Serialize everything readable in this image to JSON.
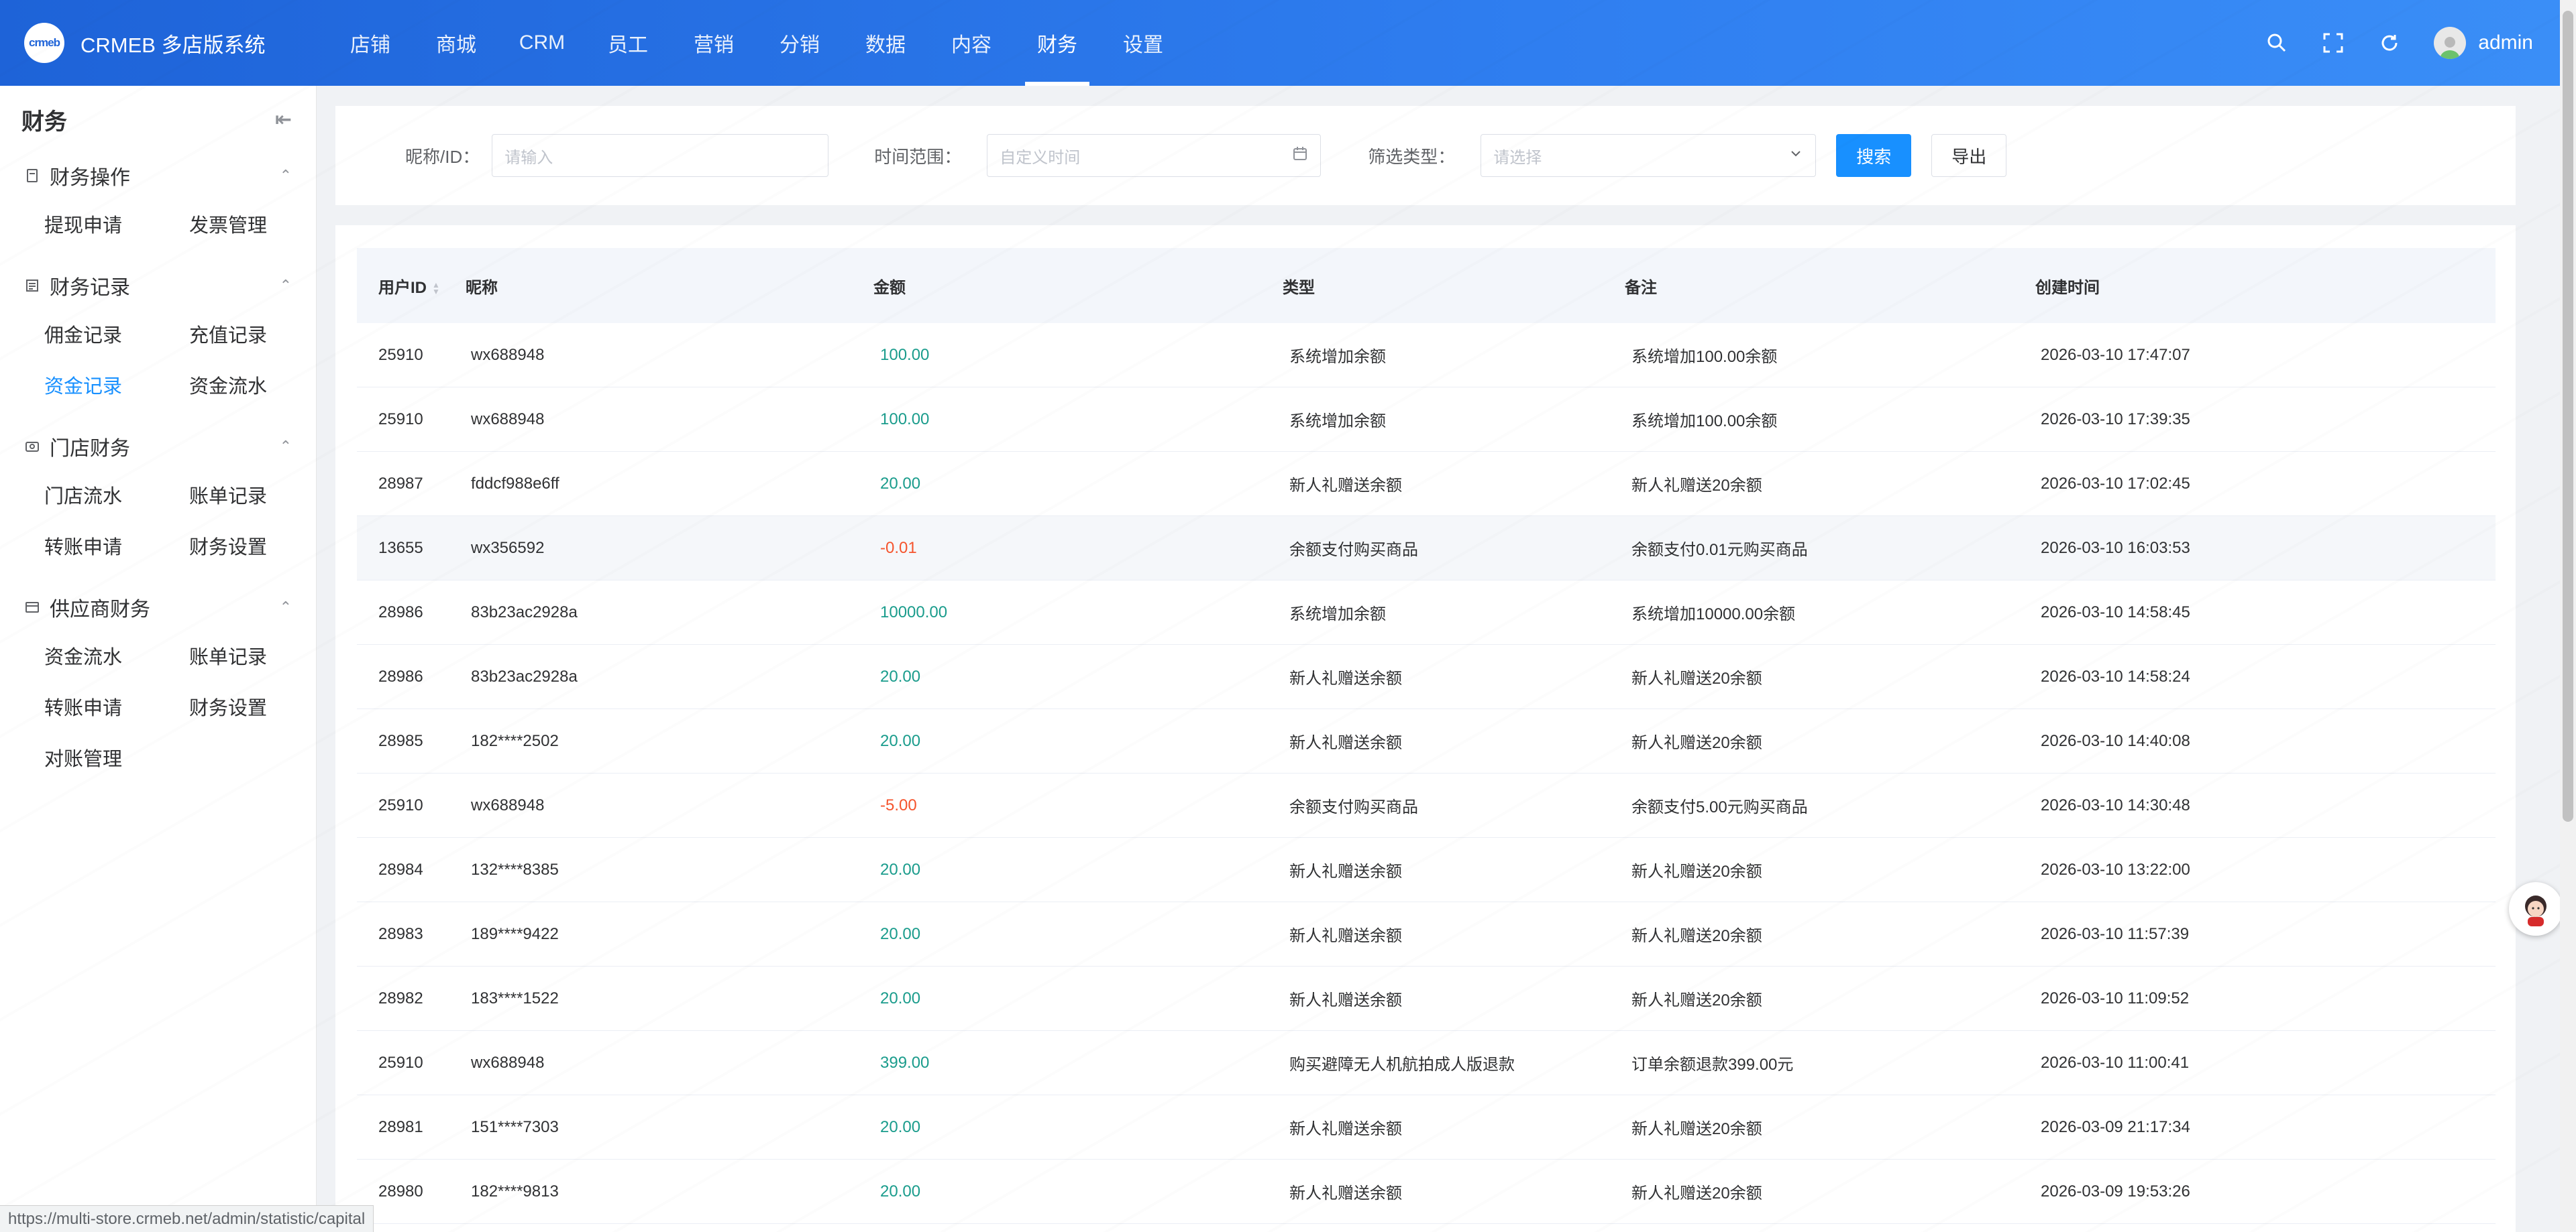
{
  "header": {
    "logo_text": "crmeb",
    "app_title": "CRMEB 多店版系统",
    "nav": [
      "店铺",
      "商城",
      "CRM",
      "员工",
      "营销",
      "分销",
      "数据",
      "内容",
      "财务",
      "设置"
    ],
    "active_nav": "财务",
    "user_name": "admin"
  },
  "sidebar": {
    "title": "财务",
    "groups": [
      {
        "label": "财务操作",
        "icon": "document-icon",
        "items": [
          "提现申请",
          "发票管理"
        ]
      },
      {
        "label": "财务记录",
        "icon": "list-icon",
        "items": [
          "佣金记录",
          "充值记录",
          "资金记录",
          "资金流水"
        ]
      },
      {
        "label": "门店财务",
        "icon": "store-icon",
        "items": [
          "门店流水",
          "账单记录",
          "转账申请",
          "财务设置"
        ]
      },
      {
        "label": "供应商财务",
        "icon": "card-icon",
        "items": [
          "资金流水",
          "账单记录",
          "转账申请",
          "财务设置",
          "对账管理"
        ]
      }
    ],
    "active_item": "资金记录"
  },
  "filter": {
    "nickname_label": "昵称/ID：",
    "nickname_placeholder": "请输入",
    "time_label": "时间范围：",
    "time_placeholder": "自定义时间",
    "type_label": "筛选类型：",
    "type_placeholder": "请选择",
    "search_btn": "搜索",
    "export_btn": "导出"
  },
  "table": {
    "columns": [
      "用户ID",
      "昵称",
      "金额",
      "类型",
      "备注",
      "创建时间"
    ],
    "rows": [
      {
        "id": "25910",
        "nickname": "wx688948",
        "amount": "100.00",
        "type": "系统增加余额",
        "remark": "系统增加100.00余额",
        "time": "2026-03-10 17:47:07"
      },
      {
        "id": "25910",
        "nickname": "wx688948",
        "amount": "100.00",
        "type": "系统增加余额",
        "remark": "系统增加100.00余额",
        "time": "2026-03-10 17:39:35"
      },
      {
        "id": "28987",
        "nickname": "fddcf988e6ff",
        "amount": "20.00",
        "type": "新人礼赠送余额",
        "remark": "新人礼赠送20余额",
        "time": "2026-03-10 17:02:45"
      },
      {
        "id": "13655",
        "nickname": "wx356592",
        "amount": "-0.01",
        "type": "余额支付购买商品",
        "remark": "余额支付0.01元购买商品",
        "time": "2026-03-10 16:03:53"
      },
      {
        "id": "28986",
        "nickname": "83b23ac2928a",
        "amount": "10000.00",
        "type": "系统增加余额",
        "remark": "系统增加10000.00余额",
        "time": "2026-03-10 14:58:45"
      },
      {
        "id": "28986",
        "nickname": "83b23ac2928a",
        "amount": "20.00",
        "type": "新人礼赠送余额",
        "remark": "新人礼赠送20余额",
        "time": "2026-03-10 14:58:24"
      },
      {
        "id": "28985",
        "nickname": "182****2502",
        "amount": "20.00",
        "type": "新人礼赠送余额",
        "remark": "新人礼赠送20余额",
        "time": "2026-03-10 14:40:08"
      },
      {
        "id": "25910",
        "nickname": "wx688948",
        "amount": "-5.00",
        "type": "余额支付购买商品",
        "remark": "余额支付5.00元购买商品",
        "time": "2026-03-10 14:30:48"
      },
      {
        "id": "28984",
        "nickname": "132****8385",
        "amount": "20.00",
        "type": "新人礼赠送余额",
        "remark": "新人礼赠送20余额",
        "time": "2026-03-10 13:22:00"
      },
      {
        "id": "28983",
        "nickname": "189****9422",
        "amount": "20.00",
        "type": "新人礼赠送余额",
        "remark": "新人礼赠送20余额",
        "time": "2026-03-10 11:57:39"
      },
      {
        "id": "28982",
        "nickname": "183****1522",
        "amount": "20.00",
        "type": "新人礼赠送余额",
        "remark": "新人礼赠送20余额",
        "time": "2026-03-10 11:09:52"
      },
      {
        "id": "25910",
        "nickname": "wx688948",
        "amount": "399.00",
        "type": "购买避障无人机航拍成人版退款",
        "remark": "订单余额退款399.00元",
        "time": "2026-03-10 11:00:41"
      },
      {
        "id": "28981",
        "nickname": "151****7303",
        "amount": "20.00",
        "type": "新人礼赠送余额",
        "remark": "新人礼赠送20余额",
        "time": "2026-03-09 21:17:34"
      },
      {
        "id": "28980",
        "nickname": "182****9813",
        "amount": "20.00",
        "type": "新人礼赠送余额",
        "remark": "新人礼赠送20余额",
        "time": "2026-03-09 19:53:26"
      }
    ]
  },
  "status_url": "https://multi-store.crmeb.net/admin/statistic/capital",
  "colors": {
    "primary": "#1890ff",
    "positive": "#1a9c8c",
    "negative": "#f5542d",
    "header_start": "#1e63d8",
    "header_end": "#3a8ef7"
  }
}
